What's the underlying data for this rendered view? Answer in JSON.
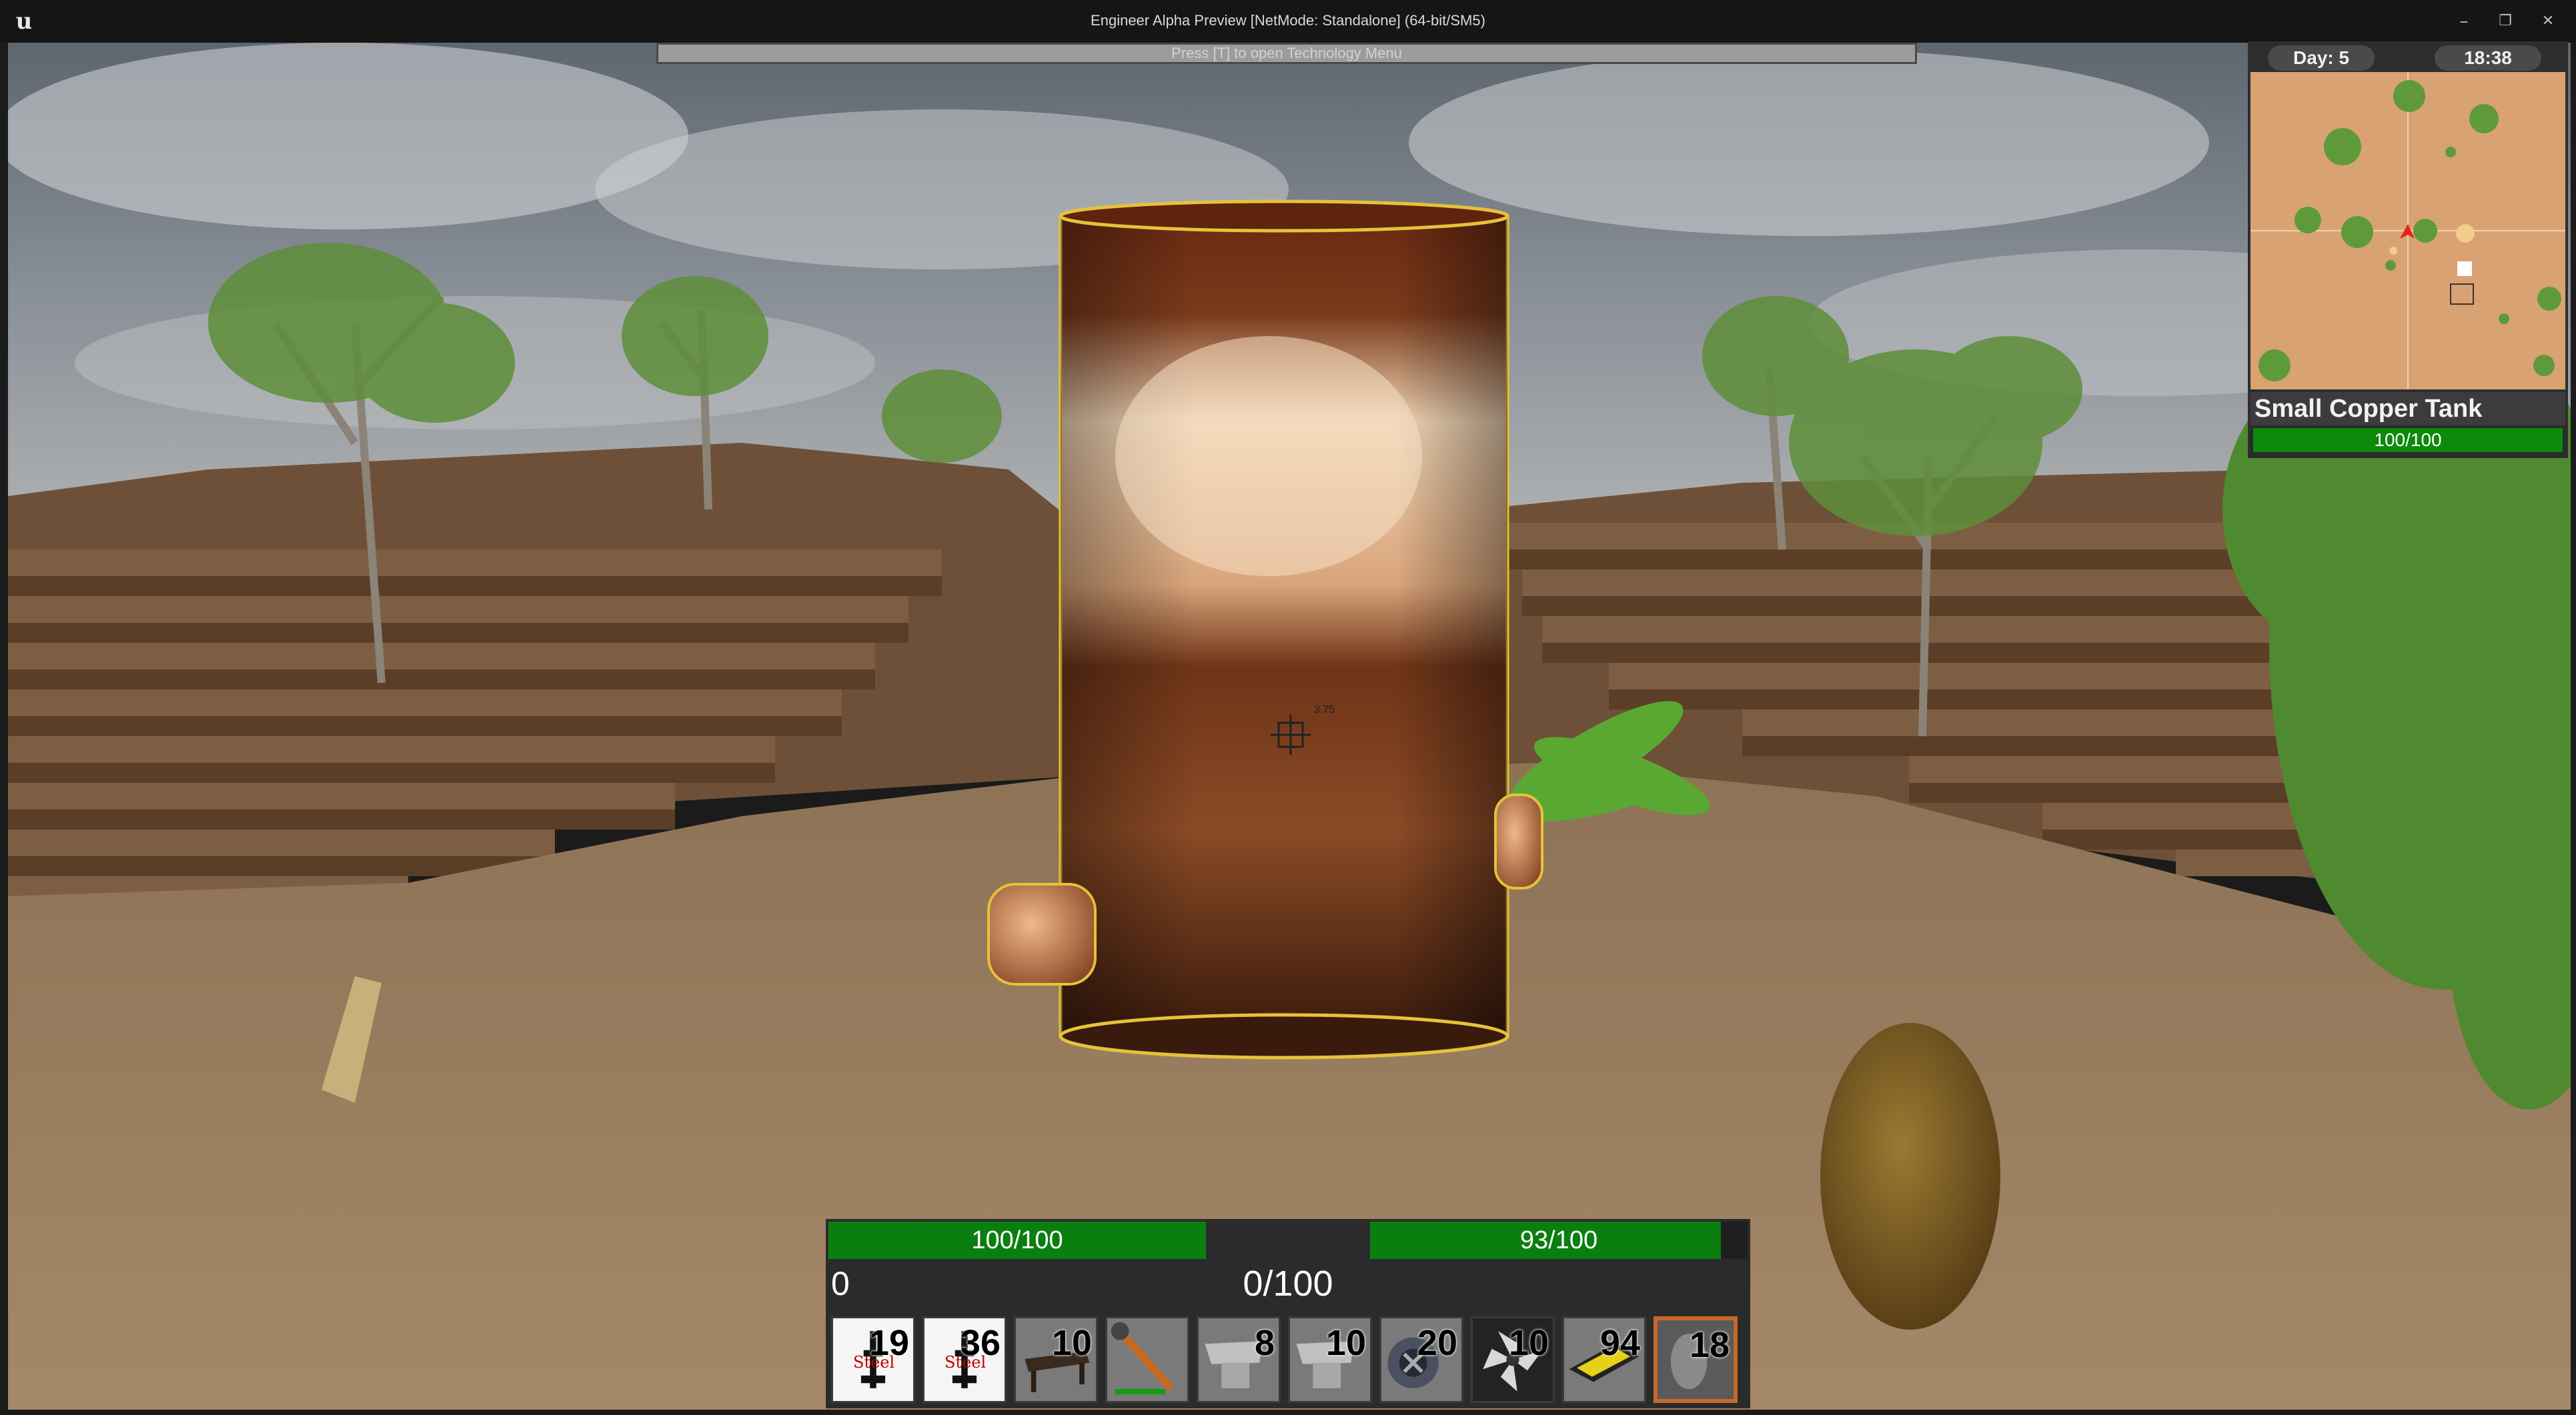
{
  "window": {
    "title": "Engineer Alpha Preview [NetMode: Standalone]  (64-bit/SM5)",
    "minimize": "–",
    "restore": "❐",
    "close": "✕",
    "logo": "u"
  },
  "hint": "Press [T] to open Technology Menu",
  "crosshair_value": "3.75",
  "clock": {
    "day": "Day: 5",
    "time": "18:38"
  },
  "target": {
    "name": "Small Copper Tank",
    "health_label": "100/100",
    "health_fraction": 1.0
  },
  "hud": {
    "left_bar": {
      "label": "100/100",
      "fraction": 1.0
    },
    "right_bar": {
      "label": "93/100",
      "fraction": 0.93
    },
    "counter_left": "0",
    "counter_mid": "0/100"
  },
  "hotbar": [
    {
      "name": "steel-icon",
      "count": "19",
      "sub": "Steel",
      "style": "white"
    },
    {
      "name": "steel-icon",
      "count": "36",
      "sub": "Steel",
      "style": "white"
    },
    {
      "name": "workbench-icon",
      "count": "10",
      "sub": "",
      "style": "grey"
    },
    {
      "name": "wrench-tool-icon",
      "count": "",
      "sub": "",
      "style": "grey",
      "durability": 0.75
    },
    {
      "name": "anvil-icon",
      "count": "8",
      "sub": "",
      "style": "grey"
    },
    {
      "name": "anvil-icon",
      "count": "10",
      "sub": "",
      "style": "grey"
    },
    {
      "name": "pipe-valve-icon",
      "count": "20",
      "sub": "",
      "style": "grey"
    },
    {
      "name": "turbine-fan-icon",
      "count": "10",
      "sub": "",
      "style": "dark"
    },
    {
      "name": "conveyor-icon",
      "count": "94",
      "sub": "",
      "style": "grey"
    },
    {
      "name": "stone-icon",
      "count": "18",
      "sub": "",
      "style": "selected"
    }
  ],
  "colors": {
    "health_green": "#0a7f10",
    "selection_orange": "#c8682a",
    "copper": "#b8683a"
  }
}
